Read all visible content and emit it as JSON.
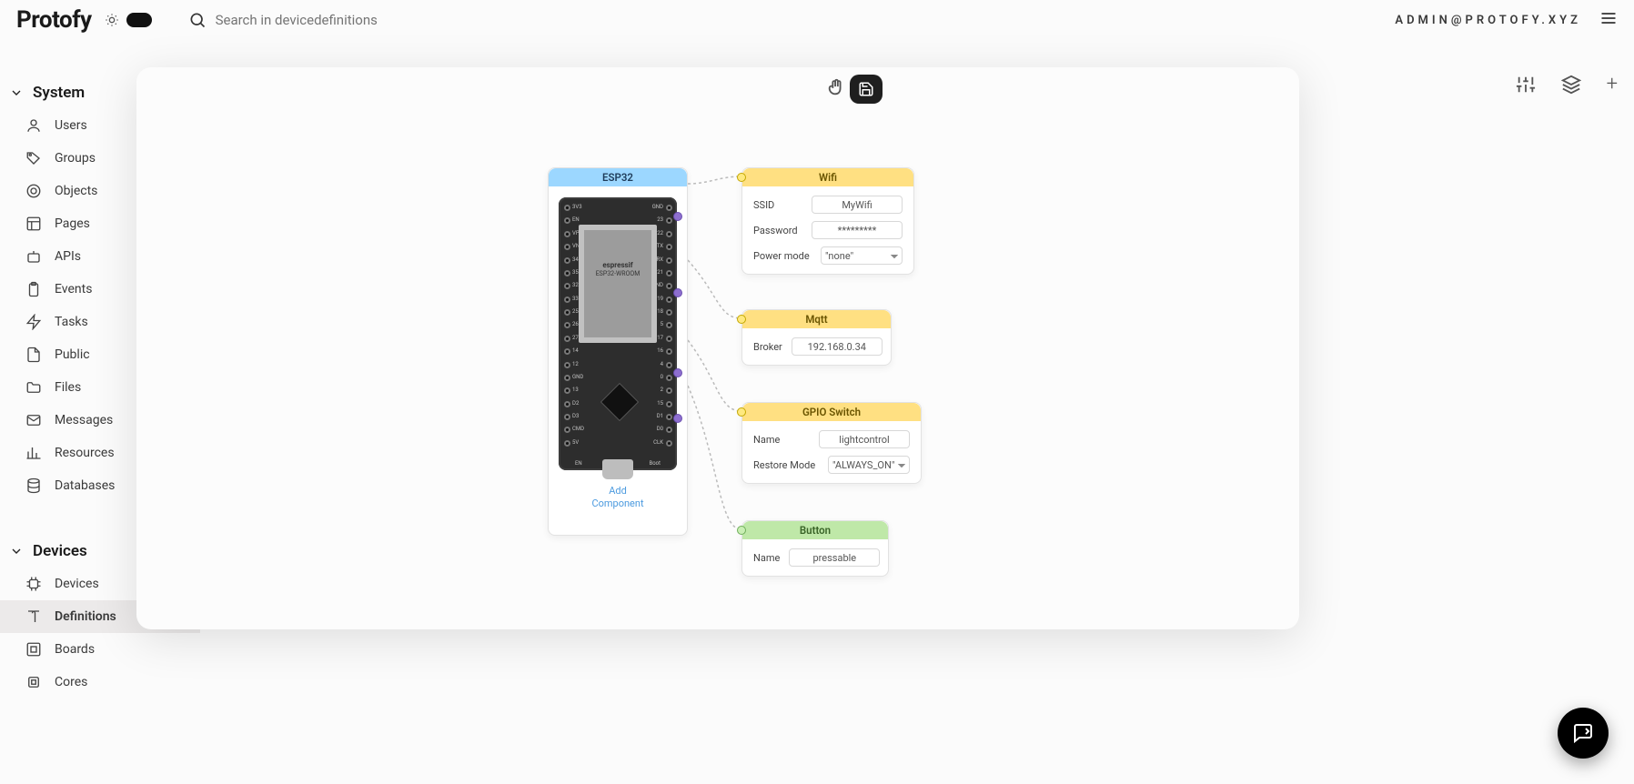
{
  "brand": "Protofy",
  "search": {
    "placeholder": "Search in devicedefinitions"
  },
  "user_email": "ADMIN@PROTOFY.XYZ",
  "sidebar": {
    "sections": [
      {
        "label": "System",
        "items": [
          {
            "label": "Users",
            "icon": "user-icon"
          },
          {
            "label": "Groups",
            "icon": "tag-icon"
          },
          {
            "label": "Objects",
            "icon": "target-icon"
          },
          {
            "label": "Pages",
            "icon": "layout-icon"
          },
          {
            "label": "APIs",
            "icon": "bot-icon"
          },
          {
            "label": "Events",
            "icon": "clipboard-icon"
          },
          {
            "label": "Tasks",
            "icon": "zap-icon"
          },
          {
            "label": "Public",
            "icon": "file-icon"
          },
          {
            "label": "Files",
            "icon": "folder-icon"
          },
          {
            "label": "Messages",
            "icon": "mail-icon"
          },
          {
            "label": "Resources",
            "icon": "bar-icon"
          },
          {
            "label": "Databases",
            "icon": "db-icon"
          }
        ]
      },
      {
        "label": "Devices",
        "items": [
          {
            "label": "Devices",
            "icon": "chip-icon"
          },
          {
            "label": "Definitions",
            "icon": "book-icon",
            "active": true
          },
          {
            "label": "Boards",
            "icon": "board-icon"
          },
          {
            "label": "Cores",
            "icon": "cpu-icon"
          }
        ]
      }
    ]
  },
  "canvas": {
    "add_component_label": "Add\nComponent",
    "esp32": {
      "title": "ESP32",
      "shield_brand": "espressif",
      "shield_model": "ESP32-WROOM",
      "left_pins": [
        "3V3",
        "EN",
        "VP",
        "VN",
        "34",
        "35",
        "32",
        "33",
        "25",
        "26",
        "27",
        "14",
        "12",
        "GND",
        "13",
        "D2",
        "D3",
        "CMD",
        "5V"
      ],
      "right_pins": [
        "GND",
        "23",
        "22",
        "TX",
        "RX",
        "21",
        "GND",
        "19",
        "18",
        "5",
        "17",
        "16",
        "4",
        "0",
        "2",
        "15",
        "D1",
        "D0",
        "CLK"
      ],
      "btn_left": "EN",
      "btn_right": "Boot"
    },
    "wifi": {
      "title": "Wifi",
      "ssid_label": "SSID",
      "ssid_value": "MyWifi",
      "password_label": "Password",
      "password_value": "*********",
      "power_label": "Power mode",
      "power_value": "\"none\""
    },
    "mqtt": {
      "title": "Mqtt",
      "broker_label": "Broker",
      "broker_value": "192.168.0.34"
    },
    "gpio": {
      "title": "GPIO Switch",
      "name_label": "Name",
      "name_value": "lightcontrol",
      "restore_label": "Restore Mode",
      "restore_value": "\"ALWAYS_ON\""
    },
    "button": {
      "title": "Button",
      "name_label": "Name",
      "name_value": "pressable"
    }
  }
}
